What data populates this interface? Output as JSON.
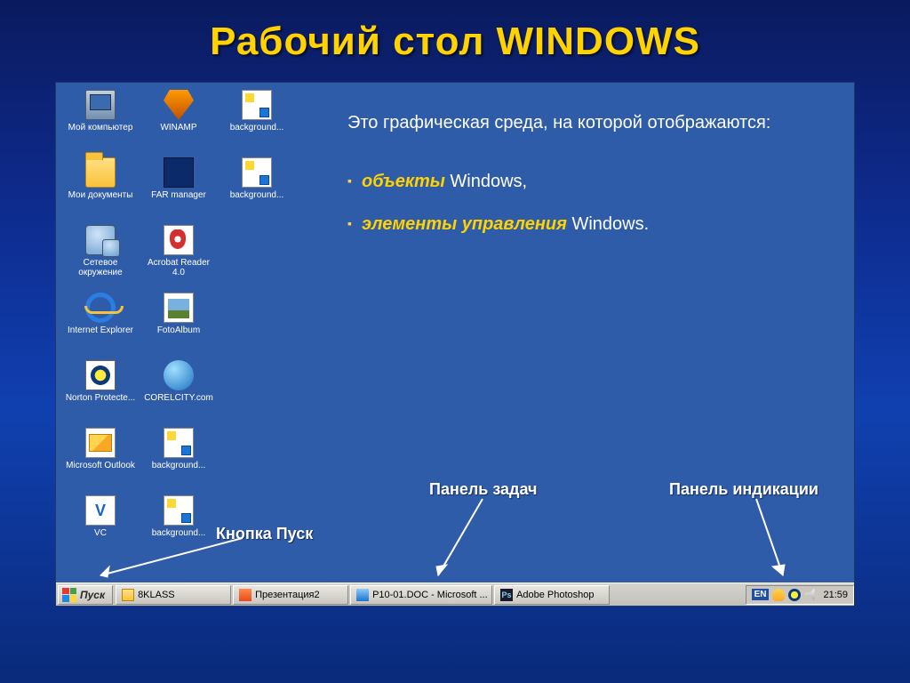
{
  "title": "Рабочий стол WINDOWS",
  "description": {
    "intro": "Это графическая среда, на которой отображаются:",
    "bullets": [
      {
        "em": "объекты",
        "rest": " Windows,"
      },
      {
        "em": "элементы управления",
        "rest": " Windows."
      }
    ]
  },
  "annotations": {
    "start_button": "Кнопка Пуск",
    "taskbar": "Панель задач",
    "systray": "Панель индикации"
  },
  "desktop_icons": [
    {
      "label": "Мой компьютер",
      "icon": "ic-computer",
      "name": "my-computer-icon"
    },
    {
      "label": "WINAMP",
      "icon": "ic-winamp",
      "name": "winamp-icon"
    },
    {
      "label": "background...",
      "icon": "ic-paint",
      "name": "background1-icon"
    },
    {
      "label": "Мои документы",
      "icon": "ic-folder",
      "name": "my-documents-icon"
    },
    {
      "label": "FAR manager",
      "icon": "ic-far",
      "name": "far-manager-icon"
    },
    {
      "label": "background...",
      "icon": "ic-paint",
      "name": "background2-icon"
    },
    {
      "label": "Сетевое окружение",
      "icon": "ic-net",
      "name": "network-icon"
    },
    {
      "label": "Acrobat Reader 4.0",
      "icon": "ic-acrobat",
      "name": "acrobat-icon"
    },
    {
      "label": "",
      "icon": "",
      "name": ""
    },
    {
      "label": "Internet Explorer",
      "icon": "ic-ie",
      "name": "ie-icon"
    },
    {
      "label": "FotoAlbum",
      "icon": "ic-photo",
      "name": "fotoalbum-icon"
    },
    {
      "label": "",
      "icon": "",
      "name": ""
    },
    {
      "label": "Norton Protecte...",
      "icon": "ic-norton",
      "name": "norton-icon"
    },
    {
      "label": "CORELCITY.com",
      "icon": "ic-globe",
      "name": "corelcity-icon"
    },
    {
      "label": "",
      "icon": "",
      "name": ""
    },
    {
      "label": "Microsoft Outlook",
      "icon": "ic-outlook",
      "name": "outlook-icon"
    },
    {
      "label": "background...",
      "icon": "ic-paint",
      "name": "background3-icon"
    },
    {
      "label": "",
      "icon": "",
      "name": ""
    },
    {
      "label": "VC",
      "icon": "ic-vc",
      "name": "vc-icon"
    },
    {
      "label": "background...",
      "icon": "ic-paint",
      "name": "background4-icon"
    }
  ],
  "taskbar": {
    "start": "Пуск",
    "tasks": [
      {
        "label": "8KLASS",
        "icon": "ti-folder",
        "name": "task-8klass"
      },
      {
        "label": "Презентация2",
        "icon": "ti-ppt",
        "name": "task-presentation2"
      },
      {
        "label": "P10-01.DOC - Microsoft ...",
        "icon": "ti-word",
        "name": "task-word-doc"
      },
      {
        "label": "Adobe Photoshop",
        "icon": "ti-ps",
        "name": "task-photoshop"
      }
    ],
    "tray": {
      "lang": "EN",
      "clock": "21:59"
    }
  }
}
